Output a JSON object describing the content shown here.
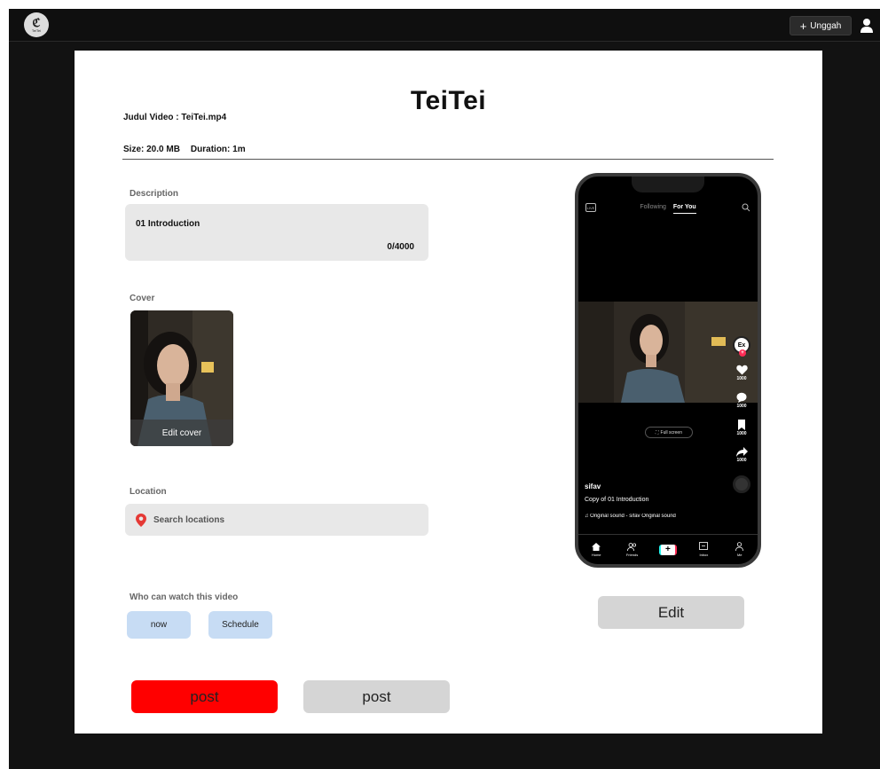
{
  "app": {
    "logo_text": "TeiTei",
    "upload_label": "Unggah",
    "upload_icon": "plus-icon",
    "user_icon": "user-icon"
  },
  "header": {
    "brand": "TeiTei",
    "video_title": "Judul Video : TeiTei.mp4",
    "size": "Size: 20.0 MB",
    "duration": "Duration: 1m"
  },
  "description": {
    "label": "Description",
    "value": "01 Introduction",
    "counter": "0/4000"
  },
  "cover": {
    "label": "Cover",
    "edit_label": "Edit cover"
  },
  "location": {
    "label": "Location",
    "placeholder": "Search locations",
    "icon": "location-pin-icon"
  },
  "privacy": {
    "label": "Who can watch this video",
    "options": [
      "now",
      "Schedule"
    ]
  },
  "actions": {
    "post_primary": "post",
    "post_secondary": "post",
    "edit": "Edit"
  },
  "preview": {
    "live_label": "LIVE",
    "tab_following": "Following",
    "tab_foryou": "For You",
    "avatar_text": "Ex",
    "like_count": "1000",
    "comment_count": "1000",
    "save_count": "1000",
    "share_count": "1000",
    "fullscreen_label": "Full screen",
    "username": "sifav",
    "caption": "Copy of 01 Introduction",
    "sound": "Original sound - sifav   Original sound",
    "nav": [
      "Home",
      "Friends",
      "",
      "Inbox",
      "Me"
    ]
  },
  "colors": {
    "background": "#121212",
    "card": "#ffffff",
    "post_primary": "#ff0000",
    "option_bg": "#c7dcf4",
    "field_bg": "#e8e8e8",
    "location_pin": "#e53935"
  }
}
